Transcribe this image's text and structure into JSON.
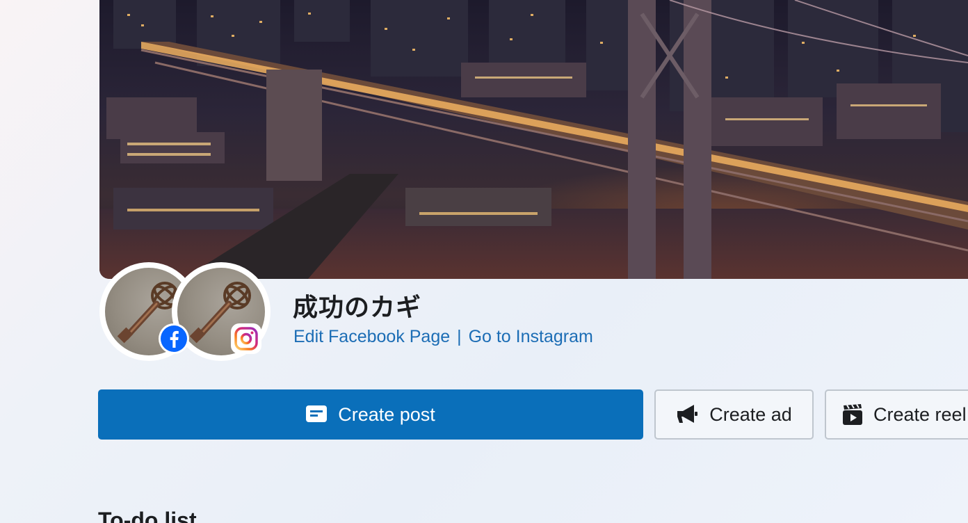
{
  "page": {
    "name": "成功のカギ",
    "links": {
      "edit_facebook": "Edit Facebook Page",
      "separator": "|",
      "go_instagram": "Go to Instagram"
    }
  },
  "actions": {
    "create_post": "Create post",
    "create_ad": "Create ad",
    "create_reel": "Create reel"
  },
  "todo": {
    "heading": "To-do list"
  },
  "colors": {
    "primary": "#0a6fba",
    "link": "#1c6db5",
    "facebook": "#0866ff",
    "text": "#1c1e21"
  },
  "icons": {
    "cover": "city-bridge-night-photo",
    "profile": "antique-key-photo",
    "facebook_badge": "facebook-icon",
    "instagram_badge": "instagram-icon",
    "post": "post-icon",
    "ad": "megaphone-icon",
    "reel": "reel-icon"
  }
}
